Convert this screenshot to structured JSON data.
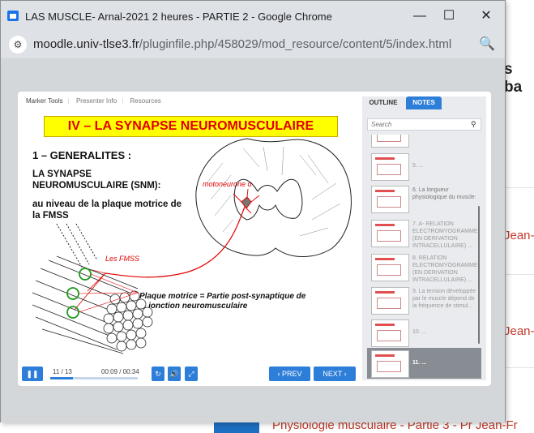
{
  "background_page": {
    "heading_fragment": "s ba",
    "item_fragment": "Jean-Fr",
    "bottom_item": "Physiologie musculaire - Partie 3 - Pr Jean-Fr"
  },
  "window": {
    "title": "LAS MUSCLE- Arnal-2021 2 heures - PARTIE 2 - Google Chrome",
    "minimize": "—",
    "maximize": "☐",
    "close": "✕"
  },
  "address": {
    "host": "moodle.univ-tlse3.fr",
    "path": "/pluginfile.php/458029/mod_resource/content/5/index.html"
  },
  "player": {
    "tabs": [
      "Marker Tools",
      "Presenter Info",
      "Resources"
    ],
    "slide": {
      "title": "IV – LA SYNAPSE NEUROMUSCULAIRE",
      "heading": "1 – GENERALITES :",
      "snm": "LA SYNAPSE NEUROMUSCULAIRE  (SNM):",
      "location": "au niveau de la plaque motrice de la FMSS",
      "motoneurone": "motoneurone α",
      "fmss": "Les FMSS",
      "plaque": "Plaque motrice = Partie post-synaptique de la jonction neuromusculaire"
    },
    "controls": {
      "pause": "❚❚",
      "slide_counter": "11 / 13",
      "time": "00:09 / 00:34",
      "progress_percent": 26,
      "replay": "↻",
      "volume": "🔊",
      "fullscreen": "⤢",
      "prev": "‹  PREV",
      "next": "NEXT  ›"
    },
    "side": {
      "tab_outline": "OUTLINE",
      "tab_notes": "NOTES",
      "search_placeholder": "Search",
      "items": [
        {
          "label": "5. ..."
        },
        {
          "label": "6. La longueur physiologique du muscle:"
        },
        {
          "label": "7. A- RELATION ELECTROMYOGRAMME (EN DERIVATION INTRACELLULAIRE) ..."
        },
        {
          "label": "8. RELATION ELECTROMYOGRAMME (EN DERIVATION INTRACELLULAIRE) ..."
        },
        {
          "label": "9. La tension développée par le muscle dépend de la fréquence de stimul..."
        },
        {
          "label": "10. ..."
        },
        {
          "label": "11. ..."
        }
      ]
    }
  },
  "colors": {
    "accent": "#2d7ed8",
    "title_bg": "#ffff00",
    "title_text": "#e00000",
    "nerve": "#e00000",
    "circle": "#1a9a1a"
  }
}
